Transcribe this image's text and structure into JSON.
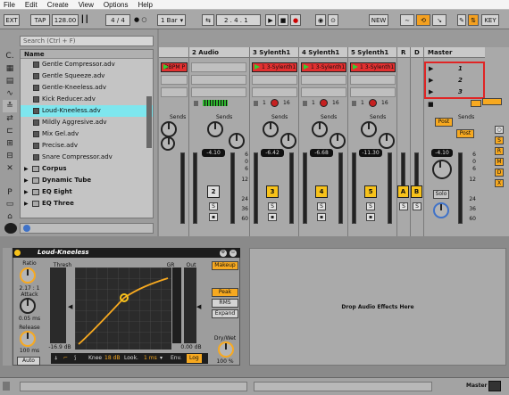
{
  "menu": [
    "File",
    "Edit",
    "Create",
    "View",
    "Options",
    "Help"
  ],
  "control": {
    "ext": "EXT",
    "tap": "TAP",
    "tempo": "128.00",
    "signature": "4 / 4",
    "loop_dots": "● ○",
    "quant": "1 Bar",
    "position": "2 .  4 .  1",
    "new": "NEW",
    "key": "KEY"
  },
  "browser": {
    "search_placeholder": "Search (Ctrl + F)",
    "col_name": "Name",
    "side_label": "C.",
    "items": [
      {
        "label": "Gentle Compressor.adv",
        "kind": "file"
      },
      {
        "label": "Gentle Squeeze.adv",
        "kind": "file"
      },
      {
        "label": "Gentle-Kneeless.adv",
        "kind": "file"
      },
      {
        "label": "Kick Reducer.adv",
        "kind": "file"
      },
      {
        "label": "Loud-Kneeless.adv",
        "kind": "file",
        "selected": true
      },
      {
        "label": "Mildly Aggresive.adv",
        "kind": "file"
      },
      {
        "label": "Mix Gel.adv",
        "kind": "file"
      },
      {
        "label": "Precise.adv",
        "kind": "file"
      },
      {
        "label": "Snare Compressor.adv",
        "kind": "file"
      },
      {
        "label": "Corpus",
        "kind": "folder"
      },
      {
        "label": "Dynamic Tube",
        "kind": "folder"
      },
      {
        "label": "EQ Eight",
        "kind": "folder"
      },
      {
        "label": "EQ Three",
        "kind": "folder"
      }
    ]
  },
  "tracks": [
    {
      "name": "",
      "clip": "DBPM P",
      "volume": "",
      "sends": "Sends",
      "num": "",
      "scale": false
    },
    {
      "name": "2 Audio",
      "clip": "",
      "volume": "-4.10",
      "sends": "Sends",
      "num": "2",
      "on": false,
      "scale": true
    },
    {
      "name": "3 Sylenth1",
      "clip": "1 3-Sylenth1",
      "volume": "-6.42",
      "sends": "Sends",
      "num": "3",
      "on": true
    },
    {
      "name": "4 Sylenth1",
      "clip": "1 3-Sylenth1",
      "volume": "-6.68",
      "sends": "Sends",
      "num": "4",
      "on": true
    },
    {
      "name": "5 Sylenth1",
      "clip": "1 3-Sylenth1",
      "volume": "-11.30",
      "sends": "Sends",
      "num": "5",
      "on": true
    }
  ],
  "returns": {
    "r": "R",
    "d": "D",
    "a": "A",
    "b": "B",
    "s": "S"
  },
  "master": {
    "name": "Master",
    "scenes": [
      "1",
      "2",
      "3"
    ],
    "post": "Post",
    "sends": "Sends",
    "volume": "-4.10",
    "solo": "Solo",
    "track_1": "1",
    "track_16": "16"
  },
  "scale_labels": [
    "6",
    "0",
    "6",
    "12",
    "24",
    "36",
    "60"
  ],
  "device": {
    "title": "Loud-Kneeless",
    "ratio_label": "Ratio",
    "ratio": "2.17 : 1",
    "attack_label": "Attack",
    "attack": "0.05 ms",
    "release_label": "Release",
    "release": "100 ms",
    "auto": "Auto",
    "thresh_label": "Thresh",
    "thresh": "-16.9 dB",
    "gr_label": "GR",
    "out_label": "Out",
    "out": "0.00 dB",
    "makeup": "Makeup",
    "peak": "Peak",
    "rms": "RMS",
    "expand": "Expand",
    "drywet_label": "Dry/Wet",
    "drywet": "100 %",
    "knee_label": "Knee",
    "knee": "18 dB",
    "look_label": "Look.",
    "look": "1 ms",
    "env_label": "Env.",
    "log": "Log"
  },
  "drop_text": "Drop Audio Effects Here",
  "status": {
    "master": "Master"
  },
  "colors": {
    "clip": "#e23030",
    "accent": "#f7a920",
    "selected": "#7ee6ee"
  }
}
